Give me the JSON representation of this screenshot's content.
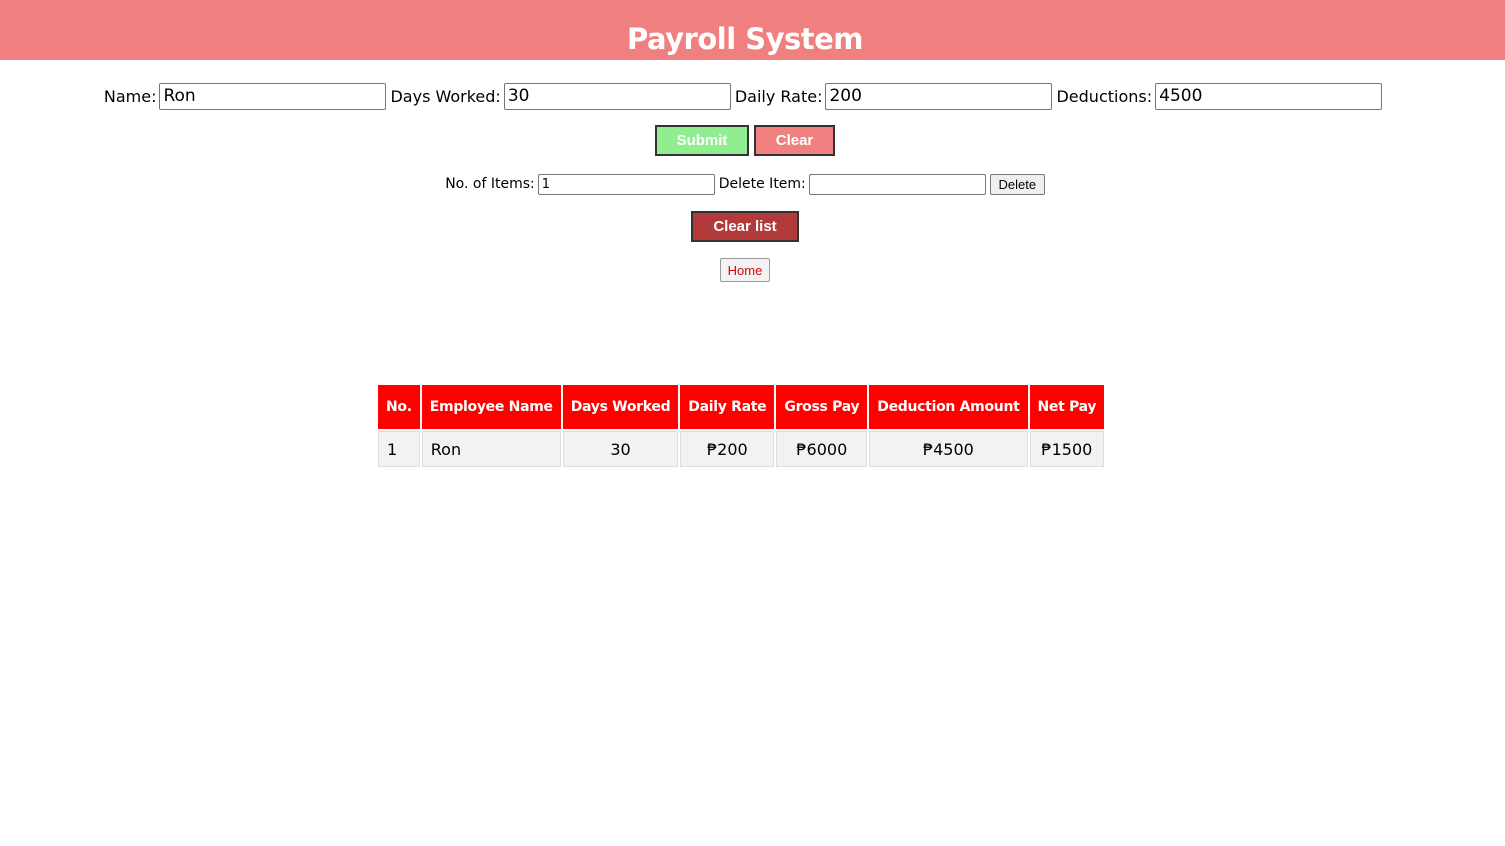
{
  "header": {
    "title": "Payroll System",
    "background_color": "#f08080"
  },
  "form": {
    "name_label": "Name:",
    "name_value": "Ron",
    "days_label": "Days Worked:",
    "days_value": "30",
    "rate_label": "Daily Rate:",
    "rate_value": "200",
    "deductions_label": "Deductions:",
    "deductions_value": "4500",
    "submit_label": "Submit",
    "clear_label": "Clear"
  },
  "items": {
    "count_label": "No. of Items:",
    "count_value": "1",
    "delete_label": "Delete Item:",
    "delete_value": "",
    "delete_button": "Delete",
    "clear_list_button": "Clear list",
    "home_button": "Home"
  },
  "table": {
    "headers": [
      "No.",
      "Employee Name",
      "Days Worked",
      "Daily Rate",
      "Gross Pay",
      "Deduction Amount",
      "Net Pay"
    ],
    "rows": [
      [
        "1",
        "Ron",
        "30",
        "₱200",
        "₱6000",
        "₱4500",
        "₱1500"
      ]
    ],
    "header_color": "#ff0000"
  },
  "colors": {
    "submit": "#90ee90",
    "clear": "#f08080",
    "clear_list": "#b33a3a",
    "home_text": "#e00000"
  }
}
